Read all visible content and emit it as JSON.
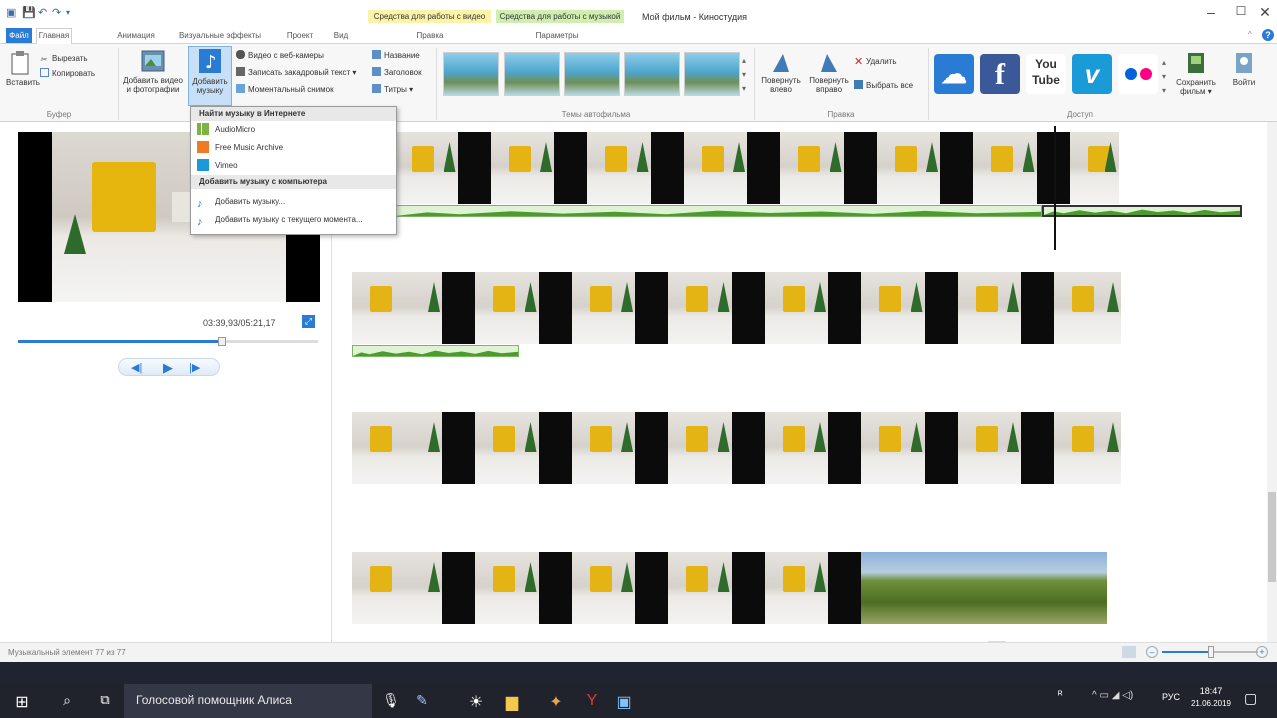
{
  "window": {
    "title": "Мой фильм - Киностудия"
  },
  "context_groups": {
    "video_tools": "Средства для работы с видео",
    "music_tools": "Средства для работы с музыкой",
    "edit_tab": "Правка",
    "options_tab": "Параметры"
  },
  "tabs": [
    "Файл",
    "Главная",
    "Анимация",
    "Визуальные эффекты",
    "Проект",
    "Вид"
  ],
  "ribbon": {
    "clipboard": {
      "paste": "Вставить",
      "cut": "Вырезать",
      "copy": "Копировать",
      "label": "Буфер"
    },
    "add": {
      "add_video": "Добавить видео и фотографии",
      "add_music": "Добавить музыку",
      "webcam": "Видео с веб-камеры",
      "record_narration": "Записать закадровый текст",
      "snapshot": "Моментальный снимок",
      "title": "Название",
      "caption": "Заголовок",
      "credits": "Титры"
    },
    "themes": {
      "label": "Темы автофильма"
    },
    "editing": {
      "rotate_left": "Повернуть влево",
      "rotate_right": "Повернуть вправо",
      "delete": "Удалить",
      "select_all": "Выбрать все",
      "label": "Правка"
    },
    "share": {
      "label": "Доступ",
      "save_movie": "Сохранить фильм",
      "sign_in": "Войти",
      "youtube": "You Tube"
    }
  },
  "dropdown": {
    "online_header": "Найти музыку в Интернете",
    "online_items": [
      "AudioMicro",
      "Free Music Archive",
      "Vimeo"
    ],
    "computer_header": "Добавить музыку с компьютера",
    "computer_items": [
      "Добавить музыку...",
      "Добавить музыку с текущего момента..."
    ]
  },
  "preview": {
    "time": "03:39,93/05:21,17",
    "progress": 0.68
  },
  "status": {
    "text": "Музыкальный элемент 77 из 77"
  },
  "taskbar": {
    "search_text": "Голосовой помощник Алиса",
    "lang": "РУС",
    "time": "18:47",
    "date": "21.06.2019"
  },
  "colors": {
    "accent": "#2a7bd4",
    "video_tools": "#fbf3a8",
    "music_tools": "#cfeeb0",
    "waveform": "#4d9a31"
  }
}
